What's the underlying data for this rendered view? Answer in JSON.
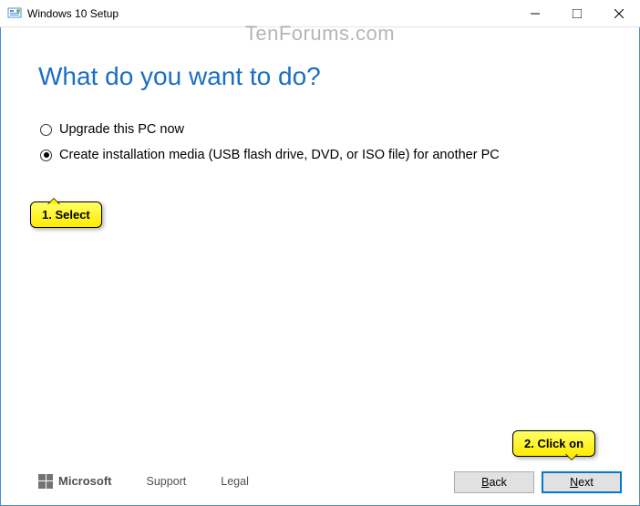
{
  "titlebar": {
    "title": "Windows 10 Setup"
  },
  "watermark": "TenForums.com",
  "heading": "What do you want to do?",
  "options": {
    "upgrade": "Upgrade this PC now",
    "create_media": "Create installation media (USB flash drive, DVD, or ISO file) for another PC"
  },
  "callouts": {
    "select": "1. Select",
    "click": "2. Click on"
  },
  "footer": {
    "brand": "Microsoft",
    "support": "Support",
    "legal": "Legal",
    "back_prefix": "B",
    "back_rest": "ack",
    "next_prefix": "N",
    "next_rest": "ext"
  }
}
